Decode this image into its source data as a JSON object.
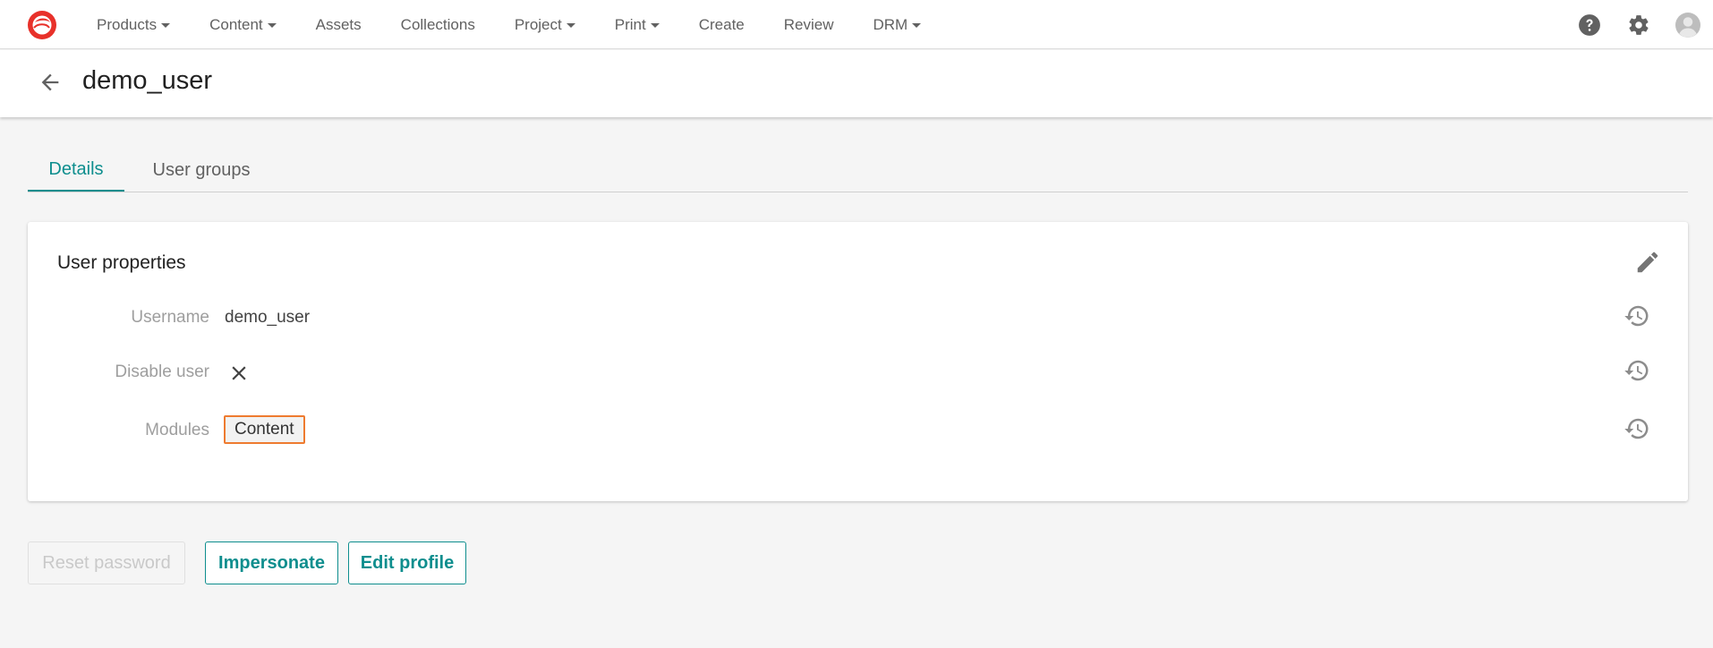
{
  "nav": {
    "items": [
      {
        "label": "Products",
        "dropdown": true
      },
      {
        "label": "Content",
        "dropdown": true
      },
      {
        "label": "Assets",
        "dropdown": false
      },
      {
        "label": "Collections",
        "dropdown": false
      },
      {
        "label": "Project",
        "dropdown": true
      },
      {
        "label": "Print",
        "dropdown": true
      },
      {
        "label": "Create",
        "dropdown": false
      },
      {
        "label": "Review",
        "dropdown": false
      },
      {
        "label": "DRM",
        "dropdown": true
      }
    ],
    "icons": [
      "help-icon",
      "gear-icon",
      "account-icon"
    ]
  },
  "header": {
    "title": "demo_user"
  },
  "tabs": [
    {
      "label": "Details",
      "active": true
    },
    {
      "label": "User groups",
      "active": false
    }
  ],
  "user_properties": {
    "title": "User properties",
    "username_label": "Username",
    "username_value": "demo_user",
    "disable_label": "Disable user",
    "disable_value": "close-icon",
    "modules_label": "Modules",
    "modules": [
      "Content"
    ]
  },
  "actions": {
    "reset_password": "Reset password",
    "impersonate": "Impersonate",
    "edit_profile": "Edit profile"
  },
  "colors": {
    "accent": "#0e8e8e",
    "logo": "#e8312a",
    "highlight": "#ee7b30"
  }
}
